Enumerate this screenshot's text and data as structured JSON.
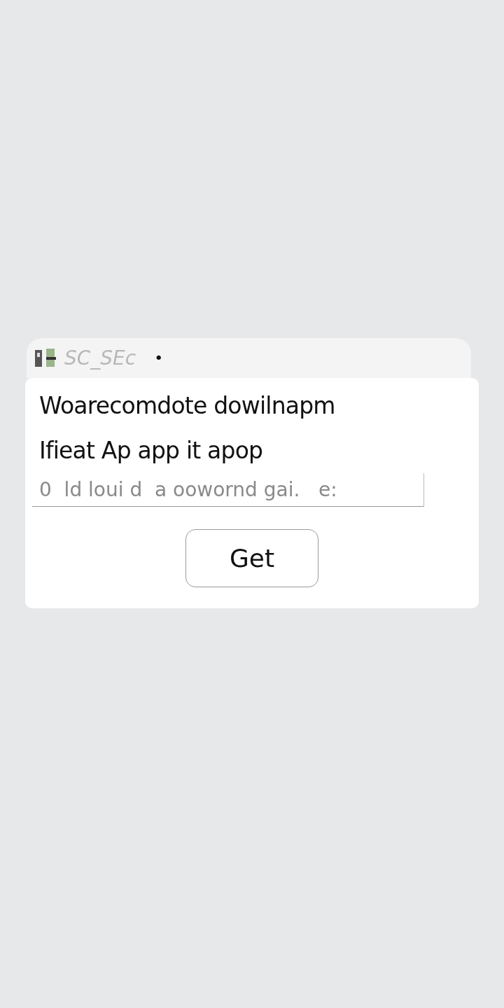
{
  "header": {
    "title": "SC_SEc",
    "dot": "•"
  },
  "dialog": {
    "lines": [
      "Woarecomdote dowilnapm",
      "Ifieat Ap app it apop"
    ],
    "field": {
      "placeholder": "0  ld loui d  a oowornd gai.   e:"
    },
    "button": "Get"
  }
}
